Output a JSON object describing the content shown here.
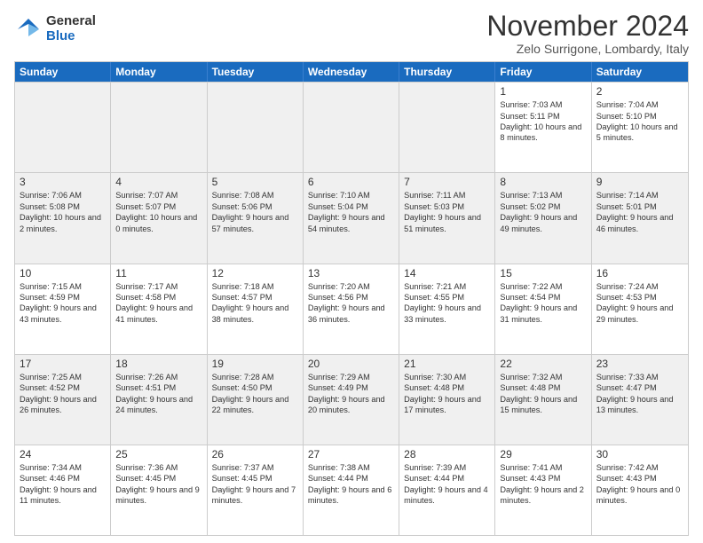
{
  "logo": {
    "general": "General",
    "blue": "Blue"
  },
  "title": "November 2024",
  "location": "Zelo Surrigone, Lombardy, Italy",
  "days_of_week": [
    "Sunday",
    "Monday",
    "Tuesday",
    "Wednesday",
    "Thursday",
    "Friday",
    "Saturday"
  ],
  "weeks": [
    [
      {
        "day": "",
        "empty": true
      },
      {
        "day": "",
        "empty": true
      },
      {
        "day": "",
        "empty": true
      },
      {
        "day": "",
        "empty": true
      },
      {
        "day": "",
        "empty": true
      },
      {
        "day": "1",
        "sunrise": "Sunrise: 7:03 AM",
        "sunset": "Sunset: 5:11 PM",
        "daylight": "Daylight: 10 hours and 8 minutes."
      },
      {
        "day": "2",
        "sunrise": "Sunrise: 7:04 AM",
        "sunset": "Sunset: 5:10 PM",
        "daylight": "Daylight: 10 hours and 5 minutes."
      }
    ],
    [
      {
        "day": "3",
        "sunrise": "Sunrise: 7:06 AM",
        "sunset": "Sunset: 5:08 PM",
        "daylight": "Daylight: 10 hours and 2 minutes."
      },
      {
        "day": "4",
        "sunrise": "Sunrise: 7:07 AM",
        "sunset": "Sunset: 5:07 PM",
        "daylight": "Daylight: 10 hours and 0 minutes."
      },
      {
        "day": "5",
        "sunrise": "Sunrise: 7:08 AM",
        "sunset": "Sunset: 5:06 PM",
        "daylight": "Daylight: 9 hours and 57 minutes."
      },
      {
        "day": "6",
        "sunrise": "Sunrise: 7:10 AM",
        "sunset": "Sunset: 5:04 PM",
        "daylight": "Daylight: 9 hours and 54 minutes."
      },
      {
        "day": "7",
        "sunrise": "Sunrise: 7:11 AM",
        "sunset": "Sunset: 5:03 PM",
        "daylight": "Daylight: 9 hours and 51 minutes."
      },
      {
        "day": "8",
        "sunrise": "Sunrise: 7:13 AM",
        "sunset": "Sunset: 5:02 PM",
        "daylight": "Daylight: 9 hours and 49 minutes."
      },
      {
        "day": "9",
        "sunrise": "Sunrise: 7:14 AM",
        "sunset": "Sunset: 5:01 PM",
        "daylight": "Daylight: 9 hours and 46 minutes."
      }
    ],
    [
      {
        "day": "10",
        "sunrise": "Sunrise: 7:15 AM",
        "sunset": "Sunset: 4:59 PM",
        "daylight": "Daylight: 9 hours and 43 minutes."
      },
      {
        "day": "11",
        "sunrise": "Sunrise: 7:17 AM",
        "sunset": "Sunset: 4:58 PM",
        "daylight": "Daylight: 9 hours and 41 minutes."
      },
      {
        "day": "12",
        "sunrise": "Sunrise: 7:18 AM",
        "sunset": "Sunset: 4:57 PM",
        "daylight": "Daylight: 9 hours and 38 minutes."
      },
      {
        "day": "13",
        "sunrise": "Sunrise: 7:20 AM",
        "sunset": "Sunset: 4:56 PM",
        "daylight": "Daylight: 9 hours and 36 minutes."
      },
      {
        "day": "14",
        "sunrise": "Sunrise: 7:21 AM",
        "sunset": "Sunset: 4:55 PM",
        "daylight": "Daylight: 9 hours and 33 minutes."
      },
      {
        "day": "15",
        "sunrise": "Sunrise: 7:22 AM",
        "sunset": "Sunset: 4:54 PM",
        "daylight": "Daylight: 9 hours and 31 minutes."
      },
      {
        "day": "16",
        "sunrise": "Sunrise: 7:24 AM",
        "sunset": "Sunset: 4:53 PM",
        "daylight": "Daylight: 9 hours and 29 minutes."
      }
    ],
    [
      {
        "day": "17",
        "sunrise": "Sunrise: 7:25 AM",
        "sunset": "Sunset: 4:52 PM",
        "daylight": "Daylight: 9 hours and 26 minutes."
      },
      {
        "day": "18",
        "sunrise": "Sunrise: 7:26 AM",
        "sunset": "Sunset: 4:51 PM",
        "daylight": "Daylight: 9 hours and 24 minutes."
      },
      {
        "day": "19",
        "sunrise": "Sunrise: 7:28 AM",
        "sunset": "Sunset: 4:50 PM",
        "daylight": "Daylight: 9 hours and 22 minutes."
      },
      {
        "day": "20",
        "sunrise": "Sunrise: 7:29 AM",
        "sunset": "Sunset: 4:49 PM",
        "daylight": "Daylight: 9 hours and 20 minutes."
      },
      {
        "day": "21",
        "sunrise": "Sunrise: 7:30 AM",
        "sunset": "Sunset: 4:48 PM",
        "daylight": "Daylight: 9 hours and 17 minutes."
      },
      {
        "day": "22",
        "sunrise": "Sunrise: 7:32 AM",
        "sunset": "Sunset: 4:48 PM",
        "daylight": "Daylight: 9 hours and 15 minutes."
      },
      {
        "day": "23",
        "sunrise": "Sunrise: 7:33 AM",
        "sunset": "Sunset: 4:47 PM",
        "daylight": "Daylight: 9 hours and 13 minutes."
      }
    ],
    [
      {
        "day": "24",
        "sunrise": "Sunrise: 7:34 AM",
        "sunset": "Sunset: 4:46 PM",
        "daylight": "Daylight: 9 hours and 11 minutes."
      },
      {
        "day": "25",
        "sunrise": "Sunrise: 7:36 AM",
        "sunset": "Sunset: 4:45 PM",
        "daylight": "Daylight: 9 hours and 9 minutes."
      },
      {
        "day": "26",
        "sunrise": "Sunrise: 7:37 AM",
        "sunset": "Sunset: 4:45 PM",
        "daylight": "Daylight: 9 hours and 7 minutes."
      },
      {
        "day": "27",
        "sunrise": "Sunrise: 7:38 AM",
        "sunset": "Sunset: 4:44 PM",
        "daylight": "Daylight: 9 hours and 6 minutes."
      },
      {
        "day": "28",
        "sunrise": "Sunrise: 7:39 AM",
        "sunset": "Sunset: 4:44 PM",
        "daylight": "Daylight: 9 hours and 4 minutes."
      },
      {
        "day": "29",
        "sunrise": "Sunrise: 7:41 AM",
        "sunset": "Sunset: 4:43 PM",
        "daylight": "Daylight: 9 hours and 2 minutes."
      },
      {
        "day": "30",
        "sunrise": "Sunrise: 7:42 AM",
        "sunset": "Sunset: 4:43 PM",
        "daylight": "Daylight: 9 hours and 0 minutes."
      }
    ]
  ]
}
